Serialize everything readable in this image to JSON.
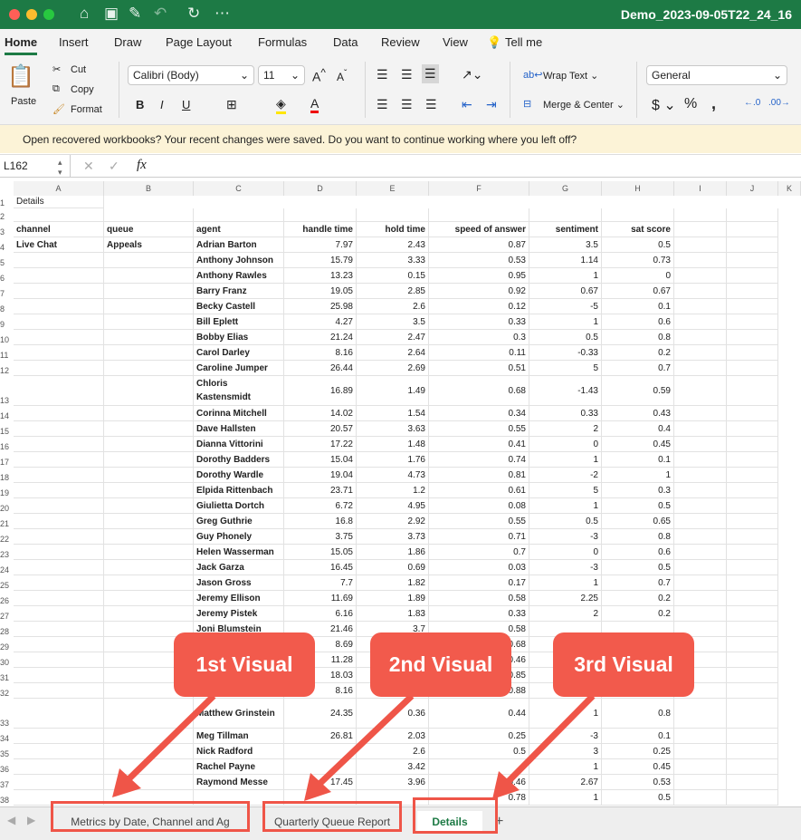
{
  "window": {
    "title": "Demo_2023-09-05T22_24_16",
    "colors": {
      "title_bar": "#1d7a45",
      "accent": "#1d7a45",
      "callout": "#f25a4c"
    }
  },
  "ribbon_tabs": [
    "Home",
    "Insert",
    "Draw",
    "Page Layout",
    "Formulas",
    "Data",
    "Review",
    "View",
    "Tell me"
  ],
  "ribbon": {
    "paste": "Paste",
    "cut": "Cut",
    "copy": "Copy",
    "format": "Format",
    "font": "Calibri (Body)",
    "size": "11",
    "wrap": "Wrap Text",
    "merge": "Merge & Center",
    "number_format": "General",
    "bold": "B",
    "italic": "I",
    "underline": "U"
  },
  "banner": {
    "text": "Open recovered workbooks?  Your recent changes were saved. Do you want to continue working where you left off?"
  },
  "formula_bar": {
    "name_box": "L162",
    "fx": "fx",
    "value": ""
  },
  "columns": [
    "A",
    "B",
    "C",
    "D",
    "E",
    "F",
    "G",
    "H",
    "I",
    "J",
    "K"
  ],
  "sheet": {
    "title_cell": "Details",
    "headers": [
      "channel",
      "queue",
      "agent",
      "handle time",
      "hold time",
      "speed of answer",
      "sentiment",
      "sat score"
    ],
    "channel": "Live Chat",
    "queue": "Appeals",
    "rows": [
      [
        "4",
        "Adrian Barton",
        "7.97",
        "2.43",
        "0.87",
        "3.5",
        "0.5"
      ],
      [
        "5",
        "Anthony Johnson",
        "15.79",
        "3.33",
        "0.53",
        "1.14",
        "0.73"
      ],
      [
        "6",
        "Anthony Rawles",
        "13.23",
        "0.15",
        "0.95",
        "1",
        "0"
      ],
      [
        "7",
        "Barry Franz",
        "19.05",
        "2.85",
        "0.92",
        "0.67",
        "0.67"
      ],
      [
        "8",
        "Becky Castell",
        "25.98",
        "2.6",
        "0.12",
        "-5",
        "0.1"
      ],
      [
        "9",
        "Bill Eplett",
        "4.27",
        "3.5",
        "0.33",
        "1",
        "0.6"
      ],
      [
        "10",
        "Bobby Elias",
        "21.24",
        "2.47",
        "0.3",
        "0.5",
        "0.8"
      ],
      [
        "11",
        "Carol Darley",
        "8.16",
        "2.64",
        "0.11",
        "-0.33",
        "0.2"
      ],
      [
        "12",
        "Caroline Jumper",
        "26.44",
        "2.69",
        "0.51",
        "5",
        "0.7"
      ],
      [
        "13",
        "Chloris Kastensmidt",
        "16.89",
        "1.49",
        "0.68",
        "-1.43",
        "0.59"
      ],
      [
        "14",
        "Corinna Mitchell",
        "14.02",
        "1.54",
        "0.34",
        "0.33",
        "0.43"
      ],
      [
        "15",
        "Dave Hallsten",
        "20.57",
        "3.63",
        "0.55",
        "2",
        "0.4"
      ],
      [
        "16",
        "Dianna Vittorini",
        "17.22",
        "1.48",
        "0.41",
        "0",
        "0.45"
      ],
      [
        "17",
        "Dorothy Badders",
        "15.04",
        "1.76",
        "0.74",
        "1",
        "0.1"
      ],
      [
        "18",
        "Dorothy Wardle",
        "19.04",
        "4.73",
        "0.81",
        "-2",
        "1"
      ],
      [
        "19",
        "Elpida Rittenbach",
        "23.71",
        "1.2",
        "0.61",
        "5",
        "0.3"
      ],
      [
        "20",
        "Giulietta Dortch",
        "6.72",
        "4.95",
        "0.08",
        "1",
        "0.5"
      ],
      [
        "21",
        "Greg Guthrie",
        "16.8",
        "2.92",
        "0.55",
        "0.5",
        "0.65"
      ],
      [
        "22",
        "Guy Phonely",
        "3.75",
        "3.73",
        "0.71",
        "-3",
        "0.8"
      ],
      [
        "23",
        "Helen Wasserman",
        "15.05",
        "1.86",
        "0.7",
        "0",
        "0.6"
      ],
      [
        "24",
        "Jack Garza",
        "16.45",
        "0.69",
        "0.03",
        "-3",
        "0.5"
      ],
      [
        "25",
        "Jason Gross",
        "7.7",
        "1.82",
        "0.17",
        "1",
        "0.7"
      ],
      [
        "26",
        "Jeremy Ellison",
        "11.69",
        "1.89",
        "0.58",
        "2.25",
        "0.2"
      ],
      [
        "27",
        "Jeremy Pistek",
        "6.16",
        "1.83",
        "0.33",
        "2",
        "0.2"
      ],
      [
        "28",
        "Joni Blumstein",
        "21.46",
        "3.7",
        "0.58",
        "",
        ""
      ],
      [
        "29",
        "",
        "8.69",
        "",
        "0.68",
        "",
        ""
      ],
      [
        "30",
        "",
        "11.28",
        "",
        "0.46",
        "",
        ""
      ],
      [
        "31",
        "",
        "18.03",
        "",
        "0.85",
        "",
        ""
      ],
      [
        "32",
        "",
        "8.16",
        "",
        "0.88",
        "",
        ""
      ],
      [
        "33",
        "Matthew Grinstein",
        "24.35",
        "0.36",
        "0.44",
        "1",
        "0.8"
      ],
      [
        "34",
        "Meg Tillman",
        "26.81",
        "2.03",
        "0.25",
        "-3",
        "0.1"
      ],
      [
        "35",
        "Nick Radford",
        "",
        "2.6",
        "0.5",
        "3",
        "0.25"
      ],
      [
        "36",
        "Rachel Payne",
        "",
        "3.42",
        "",
        "1",
        "0.45"
      ],
      [
        "37",
        "Raymond Messe",
        "17.45",
        "3.96",
        "0.46",
        "2.67",
        "0.53"
      ],
      [
        "38",
        "",
        "",
        "",
        "0.78",
        "1",
        "0.5"
      ]
    ]
  },
  "sheet_tabs": [
    {
      "label": "Metrics by Date, Channel and Ag"
    },
    {
      "label": "Quarterly Queue Report"
    },
    {
      "label": "Details",
      "active": true
    }
  ],
  "callouts": [
    "1st Visual",
    "2nd Visual",
    "3rd Visual"
  ]
}
